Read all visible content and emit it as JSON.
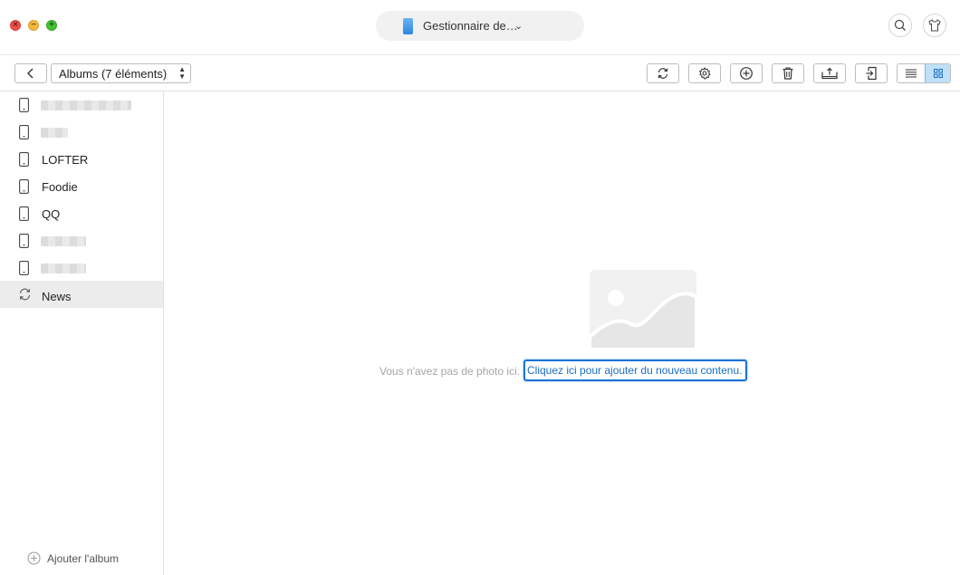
{
  "window": {
    "device_name": "Gestionnaire de…"
  },
  "toolbar": {
    "album_select": "Albums (7 éléments)"
  },
  "sidebar": {
    "items": [
      {
        "label": "",
        "icon": "phone-icon"
      },
      {
        "label": "",
        "icon": "phone-icon"
      },
      {
        "label": "LOFTER",
        "icon": "phone-icon"
      },
      {
        "label": "Foodie",
        "icon": "phone-icon"
      },
      {
        "label": "QQ",
        "icon": "phone-icon"
      },
      {
        "label": "",
        "icon": "phone-icon"
      },
      {
        "label": "",
        "icon": "phone-icon"
      },
      {
        "label": "News",
        "icon": "sync-icon"
      }
    ],
    "add_album": "Ajouter l'album"
  },
  "main": {
    "empty_message": "Vous n'avez pas de photo ici.",
    "add_content_link": "Cliquez ici pour ajouter du nouveau contenu."
  },
  "colors": {
    "accent": "#1a73d9",
    "selected_row": "#ececec",
    "view_active": "#bfe0f8"
  }
}
